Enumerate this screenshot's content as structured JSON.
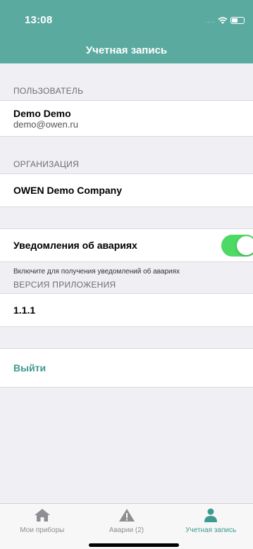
{
  "status": {
    "time": "13:08",
    "signal": "...."
  },
  "header": {
    "title": "Учетная запись"
  },
  "user_section": {
    "header": "ПОЛЬЗОВАТЕЛЬ",
    "name": "Demo Demo",
    "email": "demo@owen.ru"
  },
  "org_section": {
    "header": "ОРГАНИЗАЦИЯ",
    "name": "OWEN Demo Company"
  },
  "alarms": {
    "label": "Уведомления об авариях",
    "enabled": true,
    "footnote": "Включите для получения уведомлений об авариях"
  },
  "version_section": {
    "header": "ВЕРСИЯ ПРИЛОЖЕНИЯ",
    "value": "1.1.1"
  },
  "logout": {
    "label": "Выйти"
  },
  "tabs": [
    {
      "label": "Мои приборы",
      "icon": "home-icon",
      "active": false
    },
    {
      "label": "Аварии (2)",
      "icon": "warning-icon",
      "active": false
    },
    {
      "label": "Учетная запись",
      "icon": "user-icon",
      "active": true
    }
  ],
  "colors": {
    "accent": "#5aaaa0",
    "toggle_on": "#4cd964",
    "link": "#3d9a90"
  }
}
